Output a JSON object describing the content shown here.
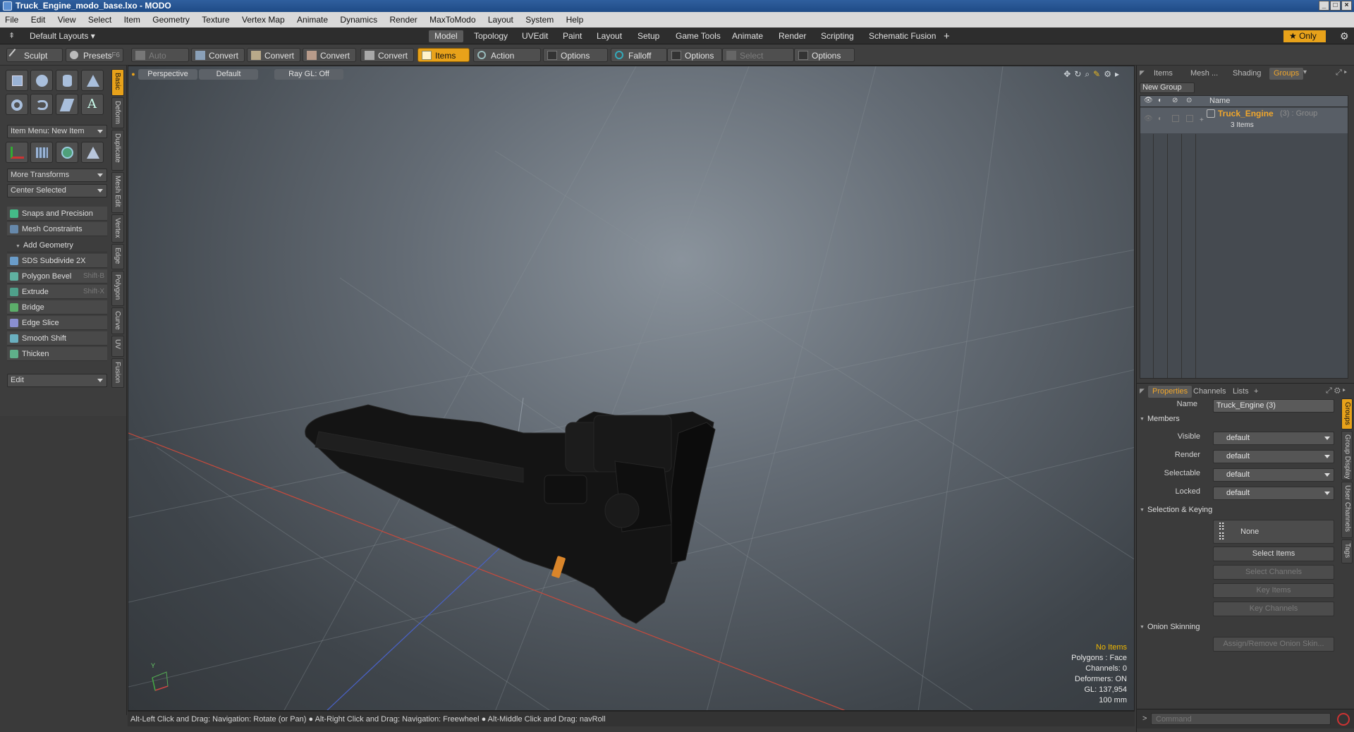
{
  "window": {
    "title": "Truck_Engine_modo_base.lxo - MODO"
  },
  "menu": [
    "File",
    "Edit",
    "View",
    "Select",
    "Item",
    "Geometry",
    "Texture",
    "Vertex Map",
    "Animate",
    "Dynamics",
    "Render",
    "MaxToModo",
    "Layout",
    "System",
    "Help"
  ],
  "layout_tabs": {
    "layouts_label": "Default Layouts",
    "tabs": [
      "Model",
      "Topology",
      "UVEdit",
      "Paint",
      "Layout",
      "Setup",
      "Game Tools",
      "Animate",
      "Render",
      "Scripting",
      "Schematic Fusion"
    ],
    "active": "Model",
    "add": "+",
    "only_label": "Only"
  },
  "toolbar": {
    "sculpt": "Sculpt",
    "presets": "Presets",
    "presets_shortcut": "F6",
    "auto_select": "Auto Select",
    "convert": "Convert",
    "items": "Items",
    "action_center": "Action Center",
    "options": "Options",
    "falloff": "Falloff",
    "select_through": "Select Through"
  },
  "left_panel": {
    "item_menu": "Item Menu: New Item",
    "more_transforms": "More Transforms",
    "center_selected": "Center Selected",
    "snaps": "Snaps and Precision",
    "mesh_constraints": "Mesh Constraints",
    "add_geometry": "Add Geometry",
    "tools": [
      {
        "label": "SDS Subdivide 2X",
        "shortcut": ""
      },
      {
        "label": "Polygon Bevel",
        "shortcut": "Shift-B"
      },
      {
        "label": "Extrude",
        "shortcut": "Shift-X"
      },
      {
        "label": "Bridge",
        "shortcut": ""
      },
      {
        "label": "Edge Slice",
        "shortcut": ""
      },
      {
        "label": "Smooth Shift",
        "shortcut": ""
      },
      {
        "label": "Thicken",
        "shortcut": ""
      }
    ],
    "edit": "Edit",
    "vertical_tabs": [
      "Basic",
      "Deform",
      "Duplicate",
      "Mesh Edit",
      "Vertex",
      "Edge",
      "Polygon",
      "Curve",
      "UV",
      "Fusion"
    ]
  },
  "viewport": {
    "view": "Perspective",
    "style": "Default",
    "raygl": "Ray GL: Off",
    "info": {
      "no_items": "No Items",
      "polygons": "Polygons : Face",
      "channels": "Channels: 0",
      "deformers": "Deformers: ON",
      "gl": "GL: 137,954",
      "scale": "100 mm"
    },
    "axis_y": "Y"
  },
  "status": "Alt-Left Click and Drag: Navigation: Rotate (or Pan) ● Alt-Right Click and Drag: Navigation: Freewheel ● Alt-Middle Click and Drag: navRoll",
  "groups_panel": {
    "tabs": [
      "Items",
      "Mesh ...",
      "Shading",
      "Groups"
    ],
    "active": "Groups",
    "new_group": "New Group",
    "col_name": "Name",
    "group_name": "Truck_Engine",
    "group_suffix": "(3) : Group",
    "group_items": "3 Items"
  },
  "properties": {
    "tabs": [
      "Properties",
      "Channels",
      "Lists"
    ],
    "add_tab": "+",
    "name_label": "Name",
    "name_value": "Truck_Engine (3)",
    "members_section": "Members",
    "fields": [
      {
        "label": "Visible",
        "value": "default"
      },
      {
        "label": "Render",
        "value": "default"
      },
      {
        "label": "Selectable",
        "value": "default"
      },
      {
        "label": "Locked",
        "value": "default"
      }
    ],
    "selection_section": "Selection & Keying",
    "none_label": "None",
    "select_items": "Select Items",
    "select_channels": "Select Channels",
    "key_items": "Key Items",
    "key_channels": "Key Channels",
    "onion_section": "Onion Skinning",
    "onion_button": "Assign/Remove Onion Skin...",
    "side_tabs": [
      "Groups",
      "Group Display",
      "User Channels",
      "Tags"
    ]
  },
  "command": {
    "prompt": ">",
    "placeholder": "Command"
  },
  "colors": {
    "accent": "#e8a21a",
    "highlight_text": "#f0b800"
  }
}
